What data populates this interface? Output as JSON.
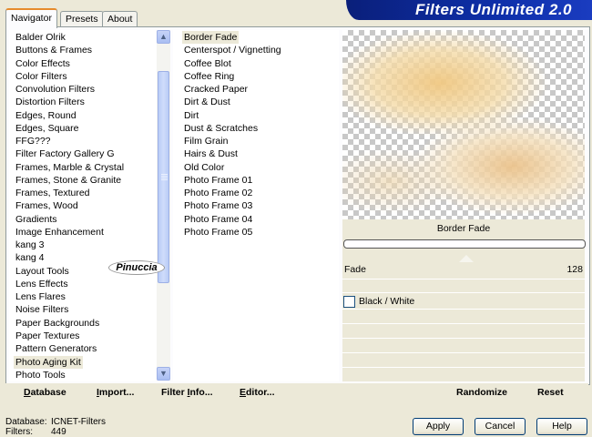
{
  "tabs": [
    {
      "label": "Navigator"
    },
    {
      "label": "Presets"
    },
    {
      "label": "About"
    }
  ],
  "banner": {
    "title": "Filters Unlimited 2.0"
  },
  "categories": [
    "Balder Olrik",
    "Buttons & Frames",
    "Color Effects",
    "Color Filters",
    "Convolution Filters",
    "Distortion Filters",
    "Edges, Round",
    "Edges, Square",
    "FFG???",
    "Filter Factory Gallery G",
    "Frames, Marble & Crystal",
    "Frames, Stone & Granite",
    "Frames, Textured",
    "Frames, Wood",
    "Gradients",
    "Image Enhancement",
    "kang 3",
    "kang 4",
    "Layout Tools",
    "Lens Effects",
    "Lens Flares",
    "Noise Filters",
    "Paper Backgrounds",
    "Paper Textures",
    "Pattern Generators",
    "Photo Aging Kit",
    "Photo Tools"
  ],
  "selected_category": "Photo Aging Kit",
  "watermark": "Pinuccia",
  "filters": [
    "Border Fade",
    "Centerspot / Vignetting",
    "Coffee Blot",
    "Coffee Ring",
    "Cracked Paper",
    "Dirt & Dust",
    "Dirt",
    "Dust & Scratches",
    "Film Grain",
    "Hairs & Dust",
    "Old Color",
    "Photo Frame 01",
    "Photo Frame 02",
    "Photo Frame 03",
    "Photo Frame 04",
    "Photo Frame 05"
  ],
  "selected_filter": "Border Fade",
  "controls": {
    "filter_title": "Border Fade",
    "fade_label": "Fade",
    "fade_value": "128",
    "checkbox_label": "Black / White",
    "checkbox_checked": false
  },
  "bottom_buttons": {
    "database": "Database",
    "import": "Import...",
    "filter_info": "Filter Info...",
    "editor": "Editor...",
    "randomize": "Randomize",
    "reset": "Reset"
  },
  "status": {
    "database_key": "Database:",
    "database_value": "ICNET-Filters",
    "filters_key": "Filters:",
    "filters_value": "449"
  },
  "dialog_buttons": {
    "apply": "Apply",
    "cancel": "Cancel",
    "help": "Help"
  }
}
